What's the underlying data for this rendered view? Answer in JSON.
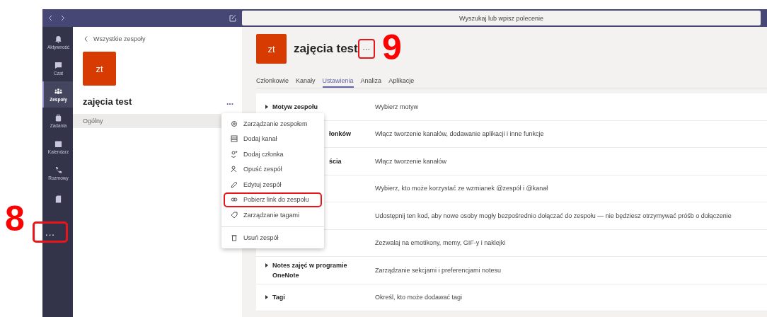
{
  "top_bar": {
    "search": {
      "placeholder": "Wyszukaj lub wpisz polecenie"
    }
  },
  "rail": {
    "items": [
      {
        "label": "Aktywność",
        "selected": false
      },
      {
        "label": "Czat",
        "selected": false
      },
      {
        "label": "Zespoły",
        "selected": true
      },
      {
        "label": "Zadania",
        "selected": false
      },
      {
        "label": "Kalendarz",
        "selected": false
      },
      {
        "label": "Rozmowy",
        "selected": false
      },
      {
        "selected": false
      }
    ],
    "more": {
      "label": "...",
      "highlighted": true
    }
  },
  "team_panel": {
    "back": "Wszystkie zespoły",
    "avatar": "zt",
    "team_name": "zajęcia test",
    "more": "...",
    "channels": [
      {
        "label": "Ogólny",
        "selected": true
      }
    ]
  },
  "menu": {
    "items": [
      {
        "label": "Zarządzanie zespołem",
        "highlighted": false
      },
      {
        "label": "Dodaj kanał",
        "highlighted": false
      },
      {
        "label": "Dodaj członka",
        "highlighted": false
      },
      {
        "label": "Opuść zespół",
        "highlighted": false
      },
      {
        "label": "Edytuj zespół",
        "highlighted": false
      },
      {
        "label": "Pobierz link do zespołu",
        "highlighted": true
      },
      {
        "label": "Zarządzanie tagami",
        "highlighted": false
      },
      {
        "label": "Usuń zespół",
        "highlighted": false
      }
    ]
  },
  "header": {
    "avatar": "zt",
    "title": "zajęcia test",
    "more": "···",
    "more_highlighted": true
  },
  "tabs": [
    {
      "label": "Członkowie",
      "selected": false
    },
    {
      "label": "Kanały",
      "selected": false
    },
    {
      "label": "Ustawienia",
      "selected": true
    },
    {
      "label": "Analiza",
      "selected": false
    },
    {
      "label": "Aplikacje",
      "selected": false
    }
  ],
  "settings": [
    {
      "label": "Motyw zespołu",
      "covered": false,
      "description": "Wybierz motyw"
    },
    {
      "label": "łonków",
      "covered": true,
      "description": "Włącz tworzenie kanałów, dodawanie aplikacji i inne funkcje"
    },
    {
      "label": "ścia",
      "covered": true,
      "description": "Włącz tworzenie kanałów"
    },
    {
      "description": "Wybierz, kto może korzystać ze wzmianek @zespół i @kanał"
    },
    {
      "description": "Udostępnij ten kod, aby nowe osoby mogły bezpośrednio dołączać do zespołu — nie będziesz otrzymywać próśb o dołączenie"
    },
    {
      "description": "Zezwalaj na emotikony, memy, GIF-y i naklejki"
    },
    {
      "label": "Notes zajęć w programie OneNote",
      "covered": false,
      "description": "Zarządzanie sekcjami i preferencjami notesu"
    },
    {
      "label": "Tagi",
      "covered": false,
      "description": "Określ, kto może dodawać tagi"
    }
  ],
  "annotations": [
    {
      "label": "8"
    },
    {
      "label": "9"
    }
  ]
}
